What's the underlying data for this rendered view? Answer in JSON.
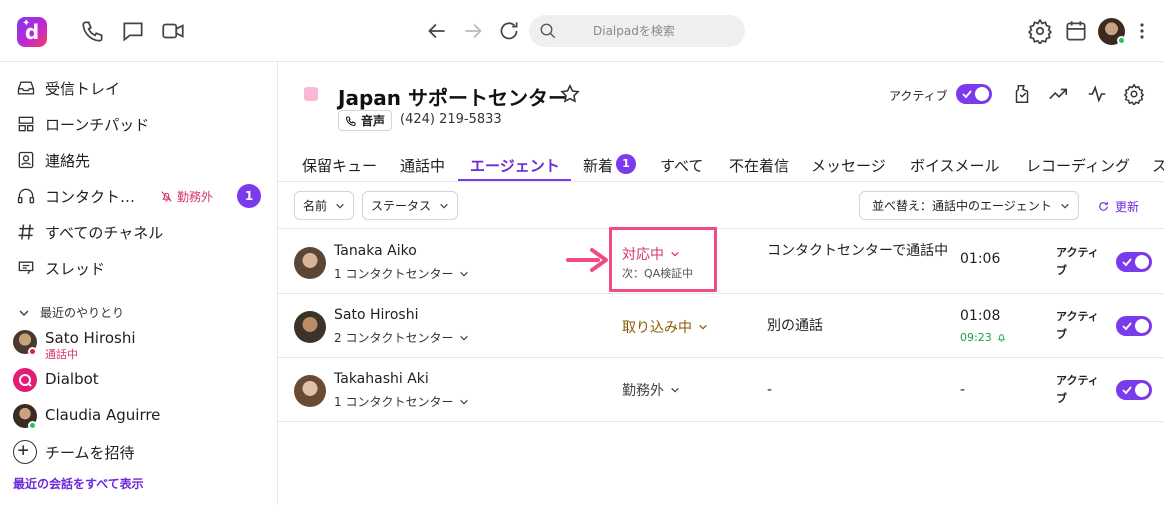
{
  "topbar": {
    "search_placeholder": "Dialpadを検索",
    "logo_letter": "d"
  },
  "sidebar": {
    "items": [
      {
        "label": "受信トレイ",
        "icon": "inbox-icon"
      },
      {
        "label": "ローンチパッド",
        "icon": "launchpad-icon"
      },
      {
        "label": "連絡先",
        "icon": "contacts-icon"
      },
      {
        "label": "コンタクト…",
        "icon": "headset-icon",
        "status": "勤務外",
        "count": "1"
      },
      {
        "label": "すべてのチャネル",
        "icon": "hash-icon"
      },
      {
        "label": "スレッド",
        "icon": "threads-icon"
      }
    ],
    "recent_heading": "最近のやりとり",
    "recent": [
      {
        "name": "Sato Hiroshi",
        "sub": "通話中"
      },
      {
        "name": "Dialbot",
        "sub": ""
      },
      {
        "name": "Claudia Aguirre",
        "sub": ""
      }
    ],
    "invite_label": "チームを招待",
    "show_all_label": "最近の会話をすべて表示"
  },
  "header": {
    "title": "Japan サポートセンター",
    "voice_label": "音声",
    "phone": "(424) 219-5833",
    "active_label": "アクティブ"
  },
  "tabs": [
    {
      "label": "保留キュー"
    },
    {
      "label": "通話中"
    },
    {
      "label": "エージェント",
      "active": true
    },
    {
      "label": "新着",
      "badge": "1"
    },
    {
      "label": "すべて"
    },
    {
      "label": "不在着信"
    },
    {
      "label": "メッセージ"
    },
    {
      "label": "ボイスメール"
    },
    {
      "label": "レコーディング"
    },
    {
      "label": "ス"
    }
  ],
  "filters": {
    "name_label": "名前",
    "status_label": "ステータス",
    "sort_label": "並べ替え：通話中のエージェント",
    "refresh_label": "更新"
  },
  "agents": [
    {
      "name": "Tanaka Aiko",
      "centers": "1 コンタクトセンター",
      "status": "対応中",
      "status_color": "#d6336c",
      "next": "次：QA検証中",
      "activity": "コンタクトセンターで通話中",
      "time": "01:06",
      "time_sub": "",
      "active": "アクティブ"
    },
    {
      "name": "Sato Hiroshi",
      "centers": "2 コンタクトセンター",
      "status": "取り込み中",
      "status_color": "#8a5a00",
      "next": "",
      "activity": "別の通話",
      "time": "01:08",
      "time_sub": "09:23",
      "active": "アクティブ"
    },
    {
      "name": "Takahashi Aki",
      "centers": "1 コンタクトセンター",
      "status": "勤務外",
      "status_color": "#444444",
      "next": "",
      "activity": "-",
      "time": "-",
      "time_sub": "",
      "active": "アクティブ"
    }
  ],
  "colors": {
    "accent": "#7c3aed",
    "highlight": "#ef4c87",
    "team_chip": "#f9b8d3"
  }
}
